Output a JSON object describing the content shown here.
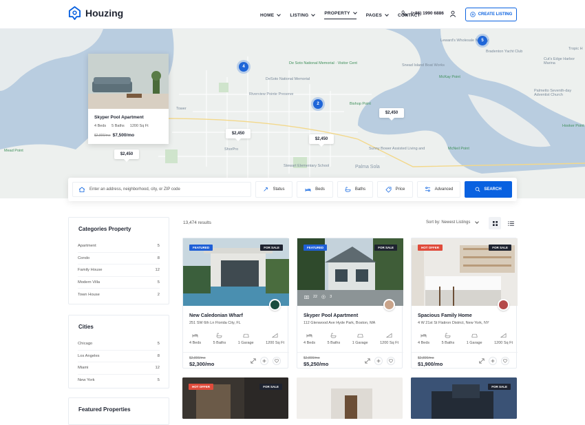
{
  "brand": {
    "name": "Houzing"
  },
  "nav": {
    "items": [
      {
        "label": "HOME",
        "dropdown": true
      },
      {
        "label": "LISTING",
        "dropdown": true
      },
      {
        "label": "PROPERTY",
        "dropdown": true,
        "active": true
      },
      {
        "label": "PAGES",
        "dropdown": true
      },
      {
        "label": "CONTACT",
        "dropdown": false
      }
    ],
    "phone": "(+86) 1990 6886",
    "cta": "CREATE LISTING"
  },
  "map": {
    "labels": [
      "De Soto National Memorial · Visitor Cent",
      "DeSoto National Memorial",
      "Riverview Pointe Preserve",
      "Bishop Point",
      "Snead Island Boat Works",
      "Bradenton Yacht Club",
      "Leward's Wholesale Nursery",
      "McKay Point",
      "Cut's Edge Harbor Marina",
      "Palmetto Seventh-day Adventist Church",
      "Tropic H",
      "Hooker Point",
      "Mead Point",
      "McNeil Point",
      "Sunny Bower Assisted Living and",
      "Stewart Elementary School",
      "Palma Sola",
      "ShorPro",
      "Tower"
    ],
    "pins": [
      "$2,450",
      "$2,450",
      "$2,450",
      "$2,450"
    ],
    "clusters": [
      "4",
      "2",
      "5"
    ],
    "popup": {
      "title": "Skyper Pool Apartment",
      "beds": "4 Beds",
      "baths": "5 Baths",
      "area": "1200 Sq Ft",
      "old_price": "$2,800/mo",
      "price": "$7,500/mo"
    }
  },
  "search": {
    "placeholder": "Enter an address, neighborhood, city, or ZIP code",
    "filters": [
      "Status",
      "Beds",
      "Baths",
      "Price",
      "Advanced"
    ],
    "button": "SEARCH"
  },
  "sidebar": {
    "categories": {
      "title": "Categories Property",
      "items": [
        {
          "label": "Apartment",
          "count": "5"
        },
        {
          "label": "Condo",
          "count": "8"
        },
        {
          "label": "Family House",
          "count": "12"
        },
        {
          "label": "Modern Villa",
          "count": "5"
        },
        {
          "label": "Town House",
          "count": "2"
        }
      ]
    },
    "cities": {
      "title": "Cities",
      "items": [
        {
          "label": "Chicago",
          "count": "5"
        },
        {
          "label": "Los Angeles",
          "count": "8"
        },
        {
          "label": "Miami",
          "count": "12"
        },
        {
          "label": "New York",
          "count": "5"
        }
      ]
    },
    "featured": {
      "title": "Featured Properties"
    }
  },
  "results": {
    "count": "13,474 results",
    "sort": "Sort by: Newest Listings"
  },
  "cards": [
    {
      "badge": "FEATURED",
      "status": "FOR SALE",
      "title": "New Caledonian Wharf",
      "address": "251 SW 6th Ln Florida City, FL",
      "beds": "4 Beds",
      "baths": "5 Baths",
      "garage": "1 Garage",
      "area": "1200 Sq Ft",
      "old_price": "$2,800/mo",
      "price": "$2,300/mo"
    },
    {
      "badge": "FEATURED",
      "status": "FOR SALE",
      "title": "Skyper Pool Apartment",
      "address": "112 Glenwood Ave Hyde Park, Boston, MA",
      "beds": "4 Beds",
      "baths": "5 Baths",
      "garage": "1 Garage",
      "area": "1200 Sq Ft",
      "old_price": "$2,800/mo",
      "price": "$5,250/mo",
      "photos": "22",
      "videos": "3"
    },
    {
      "badge": "HOT OFFER",
      "status": "FOR SALE",
      "title": "Spacious Family Home",
      "address": "4 W 21st St Flatiron District, New York, NY",
      "beds": "4 Beds",
      "baths": "5 Baths",
      "garage": "1 Garage",
      "area": "1200 Sq Ft",
      "old_price": "$2,800/mo",
      "price": "$1,900/mo"
    }
  ],
  "cards_row2": [
    {
      "badge": "HOT OFFER",
      "status": "FOR SALE"
    },
    {
      "badge": "",
      "status": ""
    },
    {
      "badge": "",
      "status": "FOR SALE"
    }
  ],
  "colors": {
    "primary": "#0961e0",
    "featured": "#1f5fd6",
    "hot": "#e04b3b",
    "for_sale": "#1e2330"
  }
}
